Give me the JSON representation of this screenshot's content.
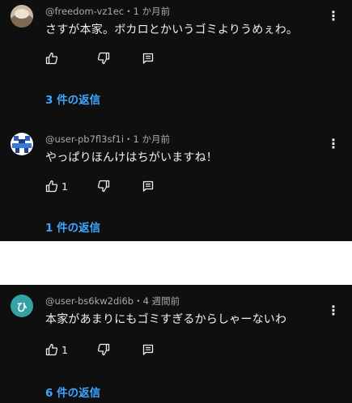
{
  "comments": [
    {
      "author": "@freedom-vz1ec",
      "time": "・1 か月前",
      "text": "さすが本家。ボカロとかいうゴミよりうめぇわ。",
      "like_count": "",
      "replies": "3 件の返信",
      "avatar_icon": "avatar-photo-icon"
    },
    {
      "author": "@user-pb7fl3sf1i",
      "time": "・1 か月前",
      "text": "やっぱりほんけはちがいますね！",
      "like_count": "1",
      "replies": "1 件の返信",
      "avatar_icon": "avatar-pixel-icon"
    },
    {
      "author": "@user-bs6kw2di6b",
      "time": "・4 週間前",
      "text": "本家があまりにもゴミすぎるからしゃーないわ",
      "like_count": "1",
      "replies": "6 件の返信",
      "avatar_icon": "avatar-letter-icon",
      "avatar_letter": "ひ"
    }
  ],
  "colors": {
    "background": "#0f0f0f",
    "text": "#f1f1f1",
    "meta": "#aaaaaa",
    "link": "#3ea6ff",
    "avatar3": "#35a0a6"
  }
}
